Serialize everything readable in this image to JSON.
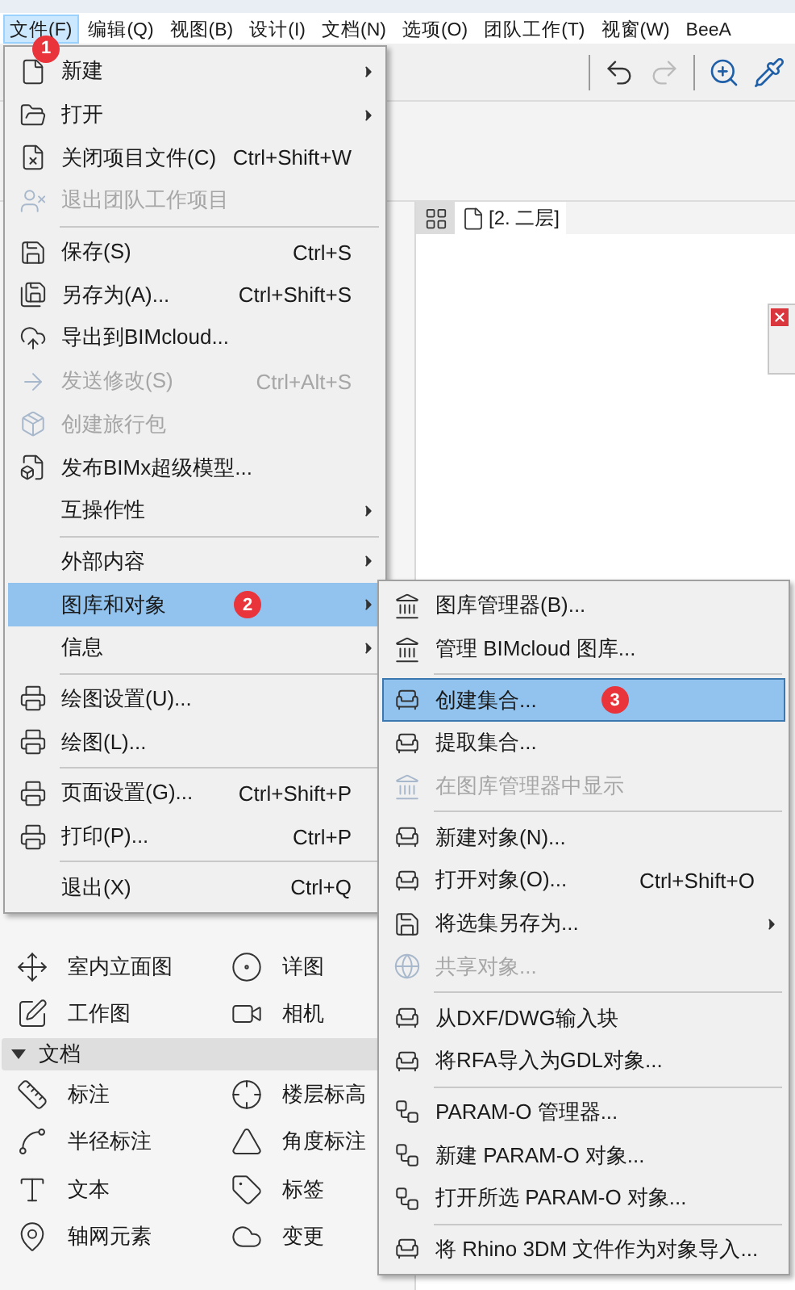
{
  "menubar": [
    {
      "label": "文件(F)",
      "selected": true,
      "badge": "1"
    },
    {
      "label": "编辑(Q)",
      "selected": false
    },
    {
      "label": "视图(B)",
      "selected": false
    },
    {
      "label": "设计(I)",
      "selected": false
    },
    {
      "label": "文档(N)",
      "selected": false
    },
    {
      "label": "选项(O)",
      "selected": false
    },
    {
      "label": "团队工作(T)",
      "selected": false
    },
    {
      "label": "视窗(W)",
      "selected": false
    },
    {
      "label": "BeeA",
      "selected": false
    }
  ],
  "view_tab": {
    "label": "[2. 二层]"
  },
  "file_menu": [
    {
      "kind": "item",
      "label": "新建",
      "has_submenu": true,
      "disabled": false,
      "selected": false
    },
    {
      "kind": "item",
      "label": "打开",
      "has_submenu": true,
      "disabled": false,
      "selected": false
    },
    {
      "kind": "item",
      "label": "关闭项目文件(C)",
      "shortcut": "Ctrl+Shift+W",
      "has_submenu": false,
      "disabled": false,
      "selected": false
    },
    {
      "kind": "item",
      "label": "退出团队工作项目",
      "has_submenu": false,
      "disabled": true,
      "selected": false
    },
    {
      "kind": "separator"
    },
    {
      "kind": "item",
      "label": "保存(S)",
      "shortcut": "Ctrl+S",
      "has_submenu": false,
      "disabled": false,
      "selected": false
    },
    {
      "kind": "item",
      "label": "另存为(A)...",
      "shortcut": "Ctrl+Shift+S",
      "has_submenu": false,
      "disabled": false,
      "selected": false
    },
    {
      "kind": "item",
      "label": "导出到BIMcloud...",
      "has_submenu": false,
      "disabled": false,
      "selected": false
    },
    {
      "kind": "item",
      "label": "发送修改(S)",
      "shortcut": "Ctrl+Alt+S",
      "has_submenu": false,
      "disabled": true,
      "selected": false
    },
    {
      "kind": "item",
      "label": "创建旅行包",
      "has_submenu": false,
      "disabled": true,
      "selected": false
    },
    {
      "kind": "item",
      "label": "发布BIMx超级模型...",
      "has_submenu": false,
      "disabled": false,
      "selected": false
    },
    {
      "kind": "item",
      "label": "互操作性",
      "has_submenu": true,
      "disabled": false,
      "selected": false
    },
    {
      "kind": "separator"
    },
    {
      "kind": "item",
      "label": "外部内容",
      "has_submenu": true,
      "disabled": false,
      "selected": false
    },
    {
      "kind": "item",
      "label": "图库和对象",
      "has_submenu": true,
      "disabled": false,
      "selected": true,
      "badge": "2"
    },
    {
      "kind": "item",
      "label": "信息",
      "has_submenu": true,
      "disabled": false,
      "selected": false
    },
    {
      "kind": "separator"
    },
    {
      "kind": "item",
      "label": "绘图设置(U)...",
      "has_submenu": false,
      "disabled": false,
      "selected": false
    },
    {
      "kind": "item",
      "label": "绘图(L)...",
      "has_submenu": false,
      "disabled": false,
      "selected": false
    },
    {
      "kind": "separator"
    },
    {
      "kind": "item",
      "label": "页面设置(G)...",
      "shortcut": "Ctrl+Shift+P",
      "has_submenu": false,
      "disabled": false,
      "selected": false
    },
    {
      "kind": "item",
      "label": "打印(P)...",
      "shortcut": "Ctrl+P",
      "has_submenu": false,
      "disabled": false,
      "selected": false
    },
    {
      "kind": "separator"
    },
    {
      "kind": "item",
      "label": "退出(X)",
      "shortcut": "Ctrl+Q",
      "has_submenu": false,
      "disabled": false,
      "selected": false
    }
  ],
  "library_submenu": [
    {
      "kind": "item",
      "label": "图库管理器(B)...",
      "has_submenu": false,
      "disabled": false,
      "selected": false
    },
    {
      "kind": "item",
      "label": "管理 BIMcloud 图库...",
      "has_submenu": false,
      "disabled": false,
      "selected": false
    },
    {
      "kind": "separator"
    },
    {
      "kind": "item",
      "label": "创建集合...",
      "has_submenu": false,
      "disabled": false,
      "selected": true,
      "badge": "3"
    },
    {
      "kind": "item",
      "label": "提取集合...",
      "has_submenu": false,
      "disabled": false,
      "selected": false
    },
    {
      "kind": "item",
      "label": "在图库管理器中显示",
      "has_submenu": false,
      "disabled": true,
      "selected": false
    },
    {
      "kind": "separator"
    },
    {
      "kind": "item",
      "label": "新建对象(N)...",
      "has_submenu": false,
      "disabled": false,
      "selected": false
    },
    {
      "kind": "item",
      "label": "打开对象(O)...",
      "shortcut": "Ctrl+Shift+O",
      "has_submenu": false,
      "disabled": false,
      "selected": false
    },
    {
      "kind": "item",
      "label": "将选集另存为...",
      "has_submenu": true,
      "disabled": false,
      "selected": false
    },
    {
      "kind": "item",
      "label": "共享对象...",
      "has_submenu": false,
      "disabled": true,
      "selected": false
    },
    {
      "kind": "separator"
    },
    {
      "kind": "item",
      "label": "从DXF/DWG输入块",
      "has_submenu": false,
      "disabled": false,
      "selected": false
    },
    {
      "kind": "item",
      "label": "将RFA导入为GDL对象...",
      "has_submenu": false,
      "disabled": false,
      "selected": false
    },
    {
      "kind": "separator"
    },
    {
      "kind": "item",
      "label": "PARAM-O 管理器...",
      "has_submenu": false,
      "disabled": false,
      "selected": false
    },
    {
      "kind": "item",
      "label": "新建 PARAM-O 对象...",
      "has_submenu": false,
      "disabled": false,
      "selected": false
    },
    {
      "kind": "item",
      "label": "打开所选 PARAM-O 对象...",
      "has_submenu": false,
      "disabled": false,
      "selected": false
    },
    {
      "kind": "separator"
    },
    {
      "kind": "item",
      "label": "将 Rhino 3DM 文件作为对象导入...",
      "has_submenu": false,
      "disabled": false,
      "selected": false
    }
  ],
  "toolbox": [
    {
      "kind": "tools",
      "tools": [
        "室内立面图",
        "详图"
      ]
    },
    {
      "kind": "tools",
      "tools": [
        "工作图",
        "相机"
      ]
    },
    {
      "kind": "section",
      "label": "文档",
      "expanded": true
    },
    {
      "kind": "tools",
      "tools": [
        "标注",
        "楼层标高"
      ]
    },
    {
      "kind": "tools",
      "tools": [
        "半径标注",
        "角度标注"
      ]
    },
    {
      "kind": "tools",
      "tools": [
        "文本",
        "标签"
      ]
    },
    {
      "kind": "tools",
      "tools": [
        "轴网元素",
        "变更"
      ]
    }
  ]
}
